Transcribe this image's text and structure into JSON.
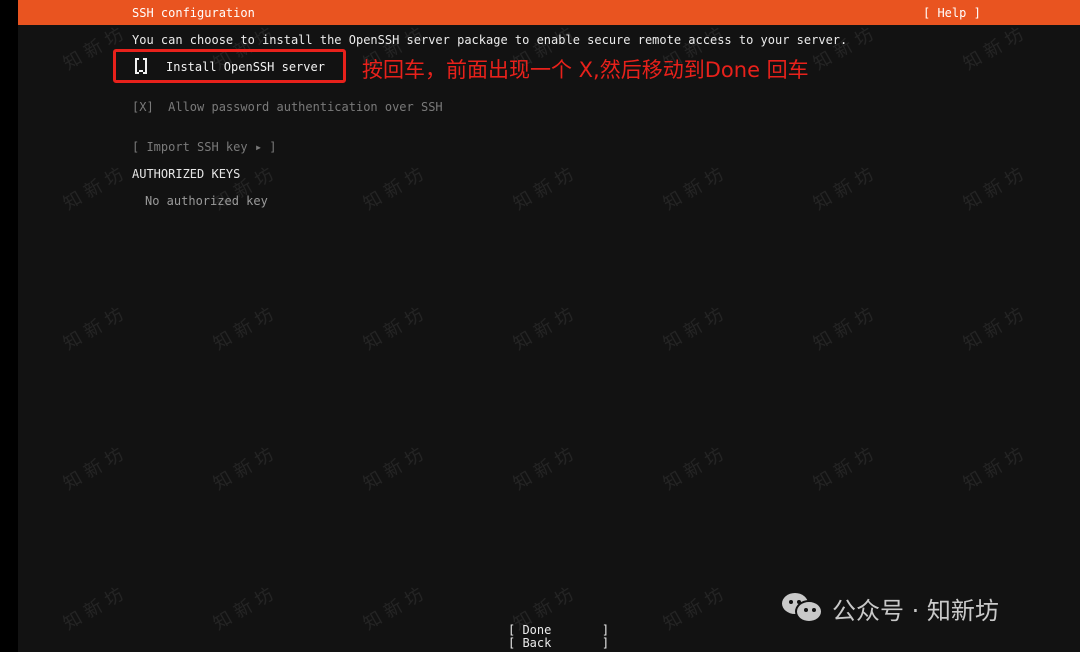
{
  "header": {
    "title": "SSH configuration",
    "help_label": "[ Help ]"
  },
  "intro_text": "You can choose to install the OpenSSH server package to enable secure remote access to your server.",
  "install_openssh": {
    "label": "Install OpenSSH server",
    "checked": false
  },
  "annotation": "按回车，前面出现一个 X,然后移动到Done 回车",
  "allow_password": {
    "label": "[X]  Allow password authentication over SSH",
    "checked": true
  },
  "import_key_label": "[ Import SSH key ▸ ]",
  "authorized_keys": {
    "heading": "AUTHORIZED KEYS",
    "empty_text": "No authorized key"
  },
  "footer": {
    "done_label": "[ Done       ]",
    "back_label": "[ Back       ]"
  },
  "watermark_text": "知 新 坊",
  "badge": {
    "icon": "wechat-icon",
    "text": "公众号 · 知新坊"
  },
  "colors": {
    "header_bg": "#e95420",
    "terminal_bg": "#121212",
    "annotation": "#e8211b"
  }
}
